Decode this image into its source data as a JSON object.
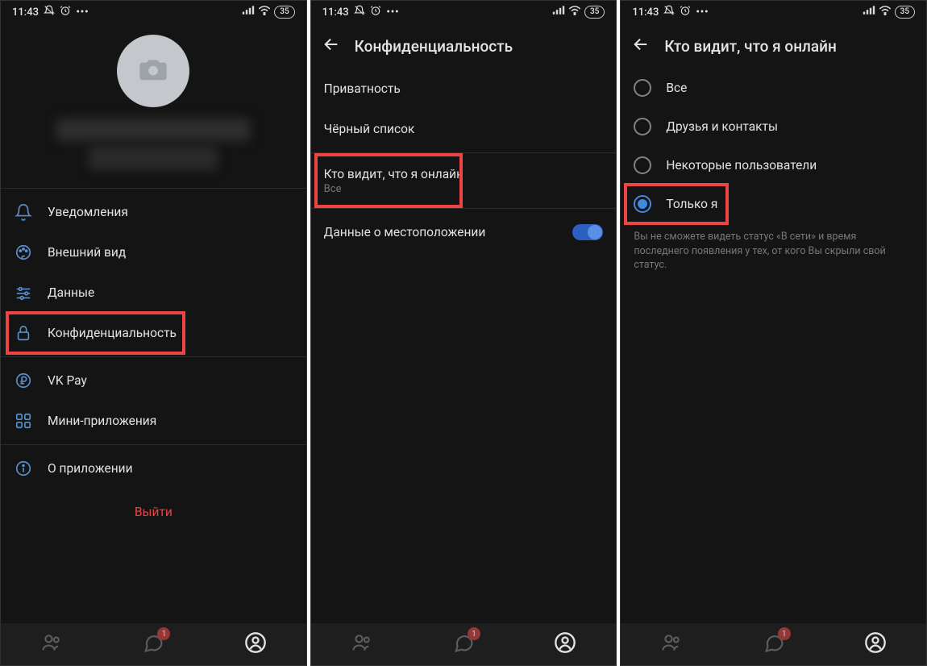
{
  "status": {
    "time": "11:43",
    "battery": "35"
  },
  "screen1": {
    "menu": {
      "notifications": "Уведомления",
      "appearance": "Внешний вид",
      "data": "Данные",
      "privacy": "Конфиденциальность",
      "vkpay": "VK Pay",
      "miniapps": "Мини-приложения",
      "about": "О приложении"
    },
    "logout": "Выйти"
  },
  "screen2": {
    "title": "Конфиденциальность",
    "rows": {
      "privacy": "Приватность",
      "blacklist": "Чёрный список",
      "who_sees_online": "Кто видит, что я онлайн",
      "who_sees_online_sub": "Все",
      "location_data": "Данные о местоположении"
    }
  },
  "screen3": {
    "title": "Кто видит, что я онлайн",
    "options": {
      "all": "Все",
      "friends": "Друзья и контакты",
      "some": "Некоторые пользователи",
      "only_me": "Только я"
    },
    "help": "Вы не сможете видеть статус «В сети» и время последнего появления у тех, от кого Вы скрыли свой статус."
  },
  "nav": {
    "badge": "1"
  }
}
